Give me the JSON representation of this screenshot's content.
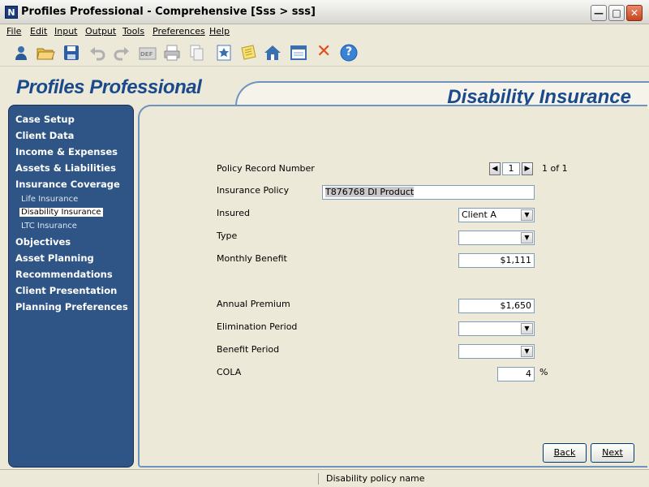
{
  "window": {
    "title": "Profiles Professional - Comprehensive [Sss  > sss]",
    "icon_text": "N",
    "min_glyph": "—",
    "max_glyph": "□",
    "close_glyph": "✕"
  },
  "menu": [
    {
      "label": "File"
    },
    {
      "label": "Edit"
    },
    {
      "label": "Input"
    },
    {
      "label": "Output"
    },
    {
      "label": "Tools"
    },
    {
      "label": "Preferences"
    },
    {
      "label": "Help"
    }
  ],
  "toolbar": {
    "icons": [
      "client-icon",
      "open-folder-icon",
      "save-icon",
      "undo-icon",
      "redo-icon",
      "def-icon",
      "print-icon",
      "copy-icon",
      "bookmark-icon",
      "notes-icon",
      "home-icon",
      "window-icon",
      "delete-icon",
      "help-icon"
    ],
    "def_text": "DEF",
    "help_text": "?",
    "delete_text": "✕"
  },
  "brand": "Profiles Professional",
  "page_heading": "Disability Insurance",
  "sidebar": {
    "items": [
      {
        "label": "Case Setup",
        "level": "main"
      },
      {
        "label": "Client Data",
        "level": "main"
      },
      {
        "label": "Income & Expenses",
        "level": "main"
      },
      {
        "label": "Assets & Liabilities",
        "level": "main"
      },
      {
        "label": "Insurance Coverage",
        "level": "main"
      },
      {
        "label": "Life Insurance",
        "level": "sub"
      },
      {
        "label": "Disability Insurance",
        "level": "sub",
        "active": true
      },
      {
        "label": "LTC Insurance",
        "level": "sub"
      },
      {
        "label": "Objectives",
        "level": "main"
      },
      {
        "label": "Asset Planning",
        "level": "main"
      },
      {
        "label": "Recommendations",
        "level": "main"
      },
      {
        "label": "Client Presentation",
        "level": "main"
      },
      {
        "label": "Planning Preferences",
        "level": "main"
      }
    ]
  },
  "form": {
    "policy_record_number": {
      "label": "Policy Record Number",
      "value": "1",
      "total": "1 of 1",
      "prev_glyph": "◀",
      "next_glyph": "▶"
    },
    "insurance_policy": {
      "label": "Insurance Policy",
      "value": "T876768   DI Product"
    },
    "insured": {
      "label": "Insured",
      "value": "Client A"
    },
    "type": {
      "label": "Type",
      "value": ""
    },
    "monthly_benefit": {
      "label": "Monthly Benefit",
      "value": "$1,111"
    },
    "annual_premium": {
      "label": "Annual Premium",
      "value": "$1,650"
    },
    "elimination_period": {
      "label": "Elimination Period",
      "value": ""
    },
    "benefit_period": {
      "label": "Benefit Period",
      "value": ""
    },
    "cola": {
      "label": "COLA",
      "value": "4",
      "unit": "%"
    },
    "dropdown_glyph": "▼"
  },
  "buttons": {
    "back": "Back",
    "next": "Next"
  },
  "status": {
    "text": "Disability policy name"
  }
}
